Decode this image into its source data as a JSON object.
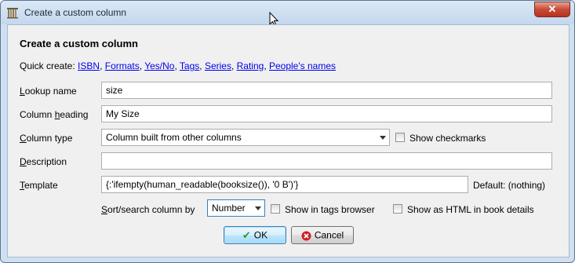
{
  "window": {
    "title": "Create a custom column",
    "close_symbol": "✕"
  },
  "dialog": {
    "heading": "Create a custom column",
    "quick_create": {
      "label": "Quick create:",
      "links": [
        "ISBN",
        "Formats",
        "Yes/No",
        "Tags",
        "Series",
        "Rating",
        "People's names"
      ]
    },
    "fields": {
      "lookup_name": {
        "label_prefix": "L",
        "label_rest": "ookup name",
        "value": "size"
      },
      "column_heading": {
        "label_before": "Column ",
        "label_mn": "h",
        "label_after": "eading",
        "value": "My Size"
      },
      "column_type": {
        "label_before": "C",
        "label_after": "olumn type",
        "value": "Column built from other columns"
      },
      "description": {
        "label_before": "D",
        "label_after": "escription",
        "value": ""
      },
      "template": {
        "label_before": "T",
        "label_after": "emplate",
        "value": "{:'ifempty(human_readable(booksize()), '0 B')'}",
        "default_text": "Default: (nothing)"
      }
    },
    "show_checkmarks": {
      "label": "Show checkmarks",
      "checked": false
    },
    "sort_search": {
      "label_before": "S",
      "label_after": "ort/search column by",
      "value": "Number"
    },
    "show_in_tags_browser": {
      "label": "Show in tags browser",
      "checked": false
    },
    "show_as_html": {
      "label": "Show as HTML in book details",
      "checked": false
    },
    "buttons": {
      "ok": "OK",
      "cancel": "Cancel"
    }
  },
  "colors": {
    "link": "#0000ee",
    "ok_icon": "#2a9d2a",
    "cancel_icon": "#cc2222"
  },
  "icons": {
    "app": "calibre-bookshelf-icon",
    "ok": "checkmark-icon",
    "cancel": "cancel-circle-icon"
  }
}
